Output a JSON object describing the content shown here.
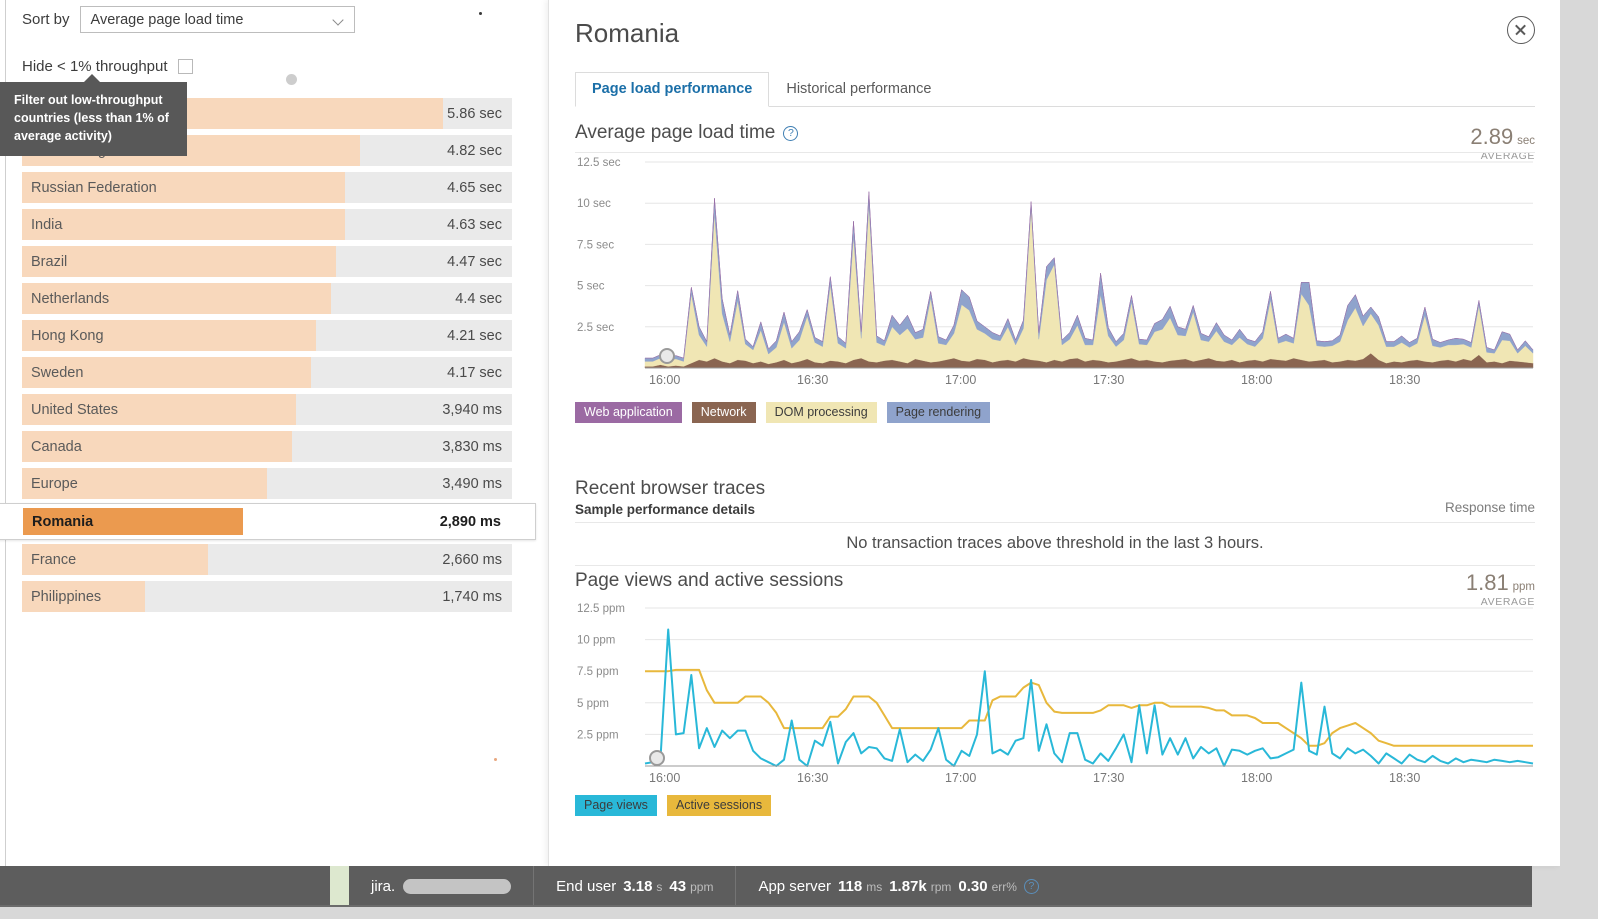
{
  "controls": {
    "sort_label": "Sort by",
    "sort_value": "Average page load time",
    "hide_label": "Hide < 1% throughput",
    "tooltip": "Filter out low-throughput countries (less than 1% of average activity)"
  },
  "country_list": [
    {
      "name": "",
      "value": "5.86 sec",
      "pct": 86,
      "selected": false
    },
    {
      "name": "United Kingdom",
      "value": "4.82 sec",
      "pct": 69,
      "selected": false
    },
    {
      "name": "Russian Federation",
      "value": "4.65 sec",
      "pct": 66,
      "selected": false
    },
    {
      "name": "India",
      "value": "4.63 sec",
      "pct": 66,
      "selected": false
    },
    {
      "name": "Brazil",
      "value": "4.47 sec",
      "pct": 64,
      "selected": false
    },
    {
      "name": "Netherlands",
      "value": "4.4 sec",
      "pct": 63,
      "selected": false
    },
    {
      "name": "Hong Kong",
      "value": "4.21 sec",
      "pct": 60,
      "selected": false
    },
    {
      "name": "Sweden",
      "value": "4.17 sec",
      "pct": 59,
      "selected": false
    },
    {
      "name": "United States",
      "value": "3,940 ms",
      "pct": 56,
      "selected": false
    },
    {
      "name": "Canada",
      "value": "3,830 ms",
      "pct": 55,
      "selected": false
    },
    {
      "name": "Europe",
      "value": "3,490 ms",
      "pct": 50,
      "selected": false
    },
    {
      "name": "Romania",
      "value": "2,890 ms",
      "pct": 41,
      "selected": true
    },
    {
      "name": "France",
      "value": "2,660 ms",
      "pct": 38,
      "selected": false
    },
    {
      "name": "Philippines",
      "value": "1,740 ms",
      "pct": 25,
      "selected": false
    }
  ],
  "panel": {
    "title": "Romania",
    "close_icon": "close-circle-icon",
    "tabs": [
      {
        "label": "Page load performance",
        "active": true
      },
      {
        "label": "Historical performance",
        "active": false
      }
    ],
    "traces": {
      "title": "Recent browser traces",
      "subtitle": "Sample performance details",
      "response_label": "Response time",
      "empty_message": "No transaction traces above threshold in the last 3 hours."
    }
  },
  "chart_data": [
    {
      "type": "area",
      "name": "page-load-time-chart",
      "title": "Average page load time",
      "help_icon": "help-circle-icon",
      "metric_value": "2.89",
      "metric_unit": "sec",
      "metric_caption": "AVERAGE",
      "ylabel": "",
      "xlabel": "",
      "ylim": [
        0,
        12.5
      ],
      "yticks": [
        "12.5 sec",
        "10 sec",
        "7.5 sec",
        "5 sec",
        "2.5 sec"
      ],
      "ytick_values": [
        12.5,
        10,
        7.5,
        5,
        2.5
      ],
      "xticks": [
        "16:00",
        "16:30",
        "17:00",
        "17:30",
        "18:00",
        "18:30"
      ],
      "grid": true,
      "stacked": true,
      "legend_position": "bottom",
      "series": [
        {
          "name": "Web application",
          "color": "#9b6aa3",
          "values": [
            0,
            0,
            0,
            0,
            0,
            0,
            0,
            0,
            0,
            0,
            0,
            0,
            0,
            0,
            0,
            0,
            0,
            0,
            0,
            0,
            0,
            0,
            0,
            0,
            0,
            0,
            0,
            0,
            0,
            0,
            0,
            0,
            0,
            0,
            0,
            0,
            0,
            0,
            0,
            0,
            0,
            0,
            0,
            0,
            0,
            0,
            0,
            0,
            0,
            0,
            0,
            0,
            0,
            0,
            0,
            0,
            0,
            0,
            0,
            0,
            0,
            0,
            0,
            0,
            0,
            0,
            0,
            0,
            0,
            0,
            0,
            0,
            0,
            0,
            0,
            0,
            0,
            0,
            0,
            0,
            0,
            0,
            0,
            0,
            0,
            0,
            0,
            0,
            0,
            0,
            0,
            0,
            0,
            0,
            0,
            0,
            0,
            0,
            0,
            0,
            0,
            0,
            0,
            0,
            0,
            0,
            0,
            0,
            0,
            0,
            0,
            0,
            0,
            0,
            0,
            0
          ]
        },
        {
          "name": "Network",
          "color": "#8a6551",
          "values": [
            0.1,
            0.1,
            0.2,
            0.1,
            0.15,
            0.1,
            0.3,
            0.5,
            0.4,
            0.6,
            0.4,
            0.3,
            0.5,
            0.45,
            0.3,
            0.4,
            0.25,
            0.35,
            0.5,
            0.3,
            0.4,
            0.55,
            0.35,
            0.3,
            0.45,
            0.4,
            0.3,
            0.5,
            0.6,
            0.4,
            0.35,
            0.45,
            0.5,
            0.4,
            0.3,
            0.55,
            0.45,
            0.35,
            0.4,
            0.5,
            0.6,
            0.45,
            0.4,
            0.55,
            0.5,
            0.35,
            0.45,
            0.5,
            0.4,
            0.6,
            0.5,
            0.45,
            0.35,
            0.5,
            0.4,
            0.55,
            0.6,
            0.4,
            0.5,
            0.45,
            0.35,
            0.4,
            0.5,
            0.6,
            0.45,
            0.5,
            0.4,
            0.35,
            0.45,
            0.5,
            0.55,
            0.4,
            0.5,
            0.6,
            0.45,
            0.4,
            0.5,
            0.35,
            0.45,
            0.5,
            0.4,
            0.55,
            0.5,
            0.45,
            0.6,
            0.5,
            0.4,
            0.45,
            0.5,
            0.35,
            0.4,
            0.5,
            0.45,
            0.55,
            0.9,
            0.5,
            0.3,
            0.4,
            0.35,
            0.45,
            0.5,
            0.4,
            0.35,
            0.45,
            0.5,
            0.4,
            0.55,
            0.45,
            0.8,
            0.35,
            0.4,
            0.3,
            0.45,
            0.4,
            0.35,
            0.3
          ]
        },
        {
          "name": "DOM processing",
          "color": "#f0e6b4",
          "values": [
            0.3,
            0.3,
            0.4,
            0.35,
            0.4,
            0.3,
            4.2,
            1.5,
            0.9,
            8.8,
            2.9,
            1.3,
            3.6,
            1.0,
            0.8,
            1.9,
            0.6,
            0.9,
            2.3,
            0.9,
            1.3,
            2.6,
            1.2,
            1.0,
            4.6,
            1.1,
            0.9,
            7.5,
            1.2,
            9.5,
            1.2,
            0.9,
            2.0,
            1.6,
            2.1,
            1.2,
            1.4,
            3.9,
            1.1,
            0.9,
            1.5,
            3.4,
            3.1,
            1.8,
            1.6,
            1.4,
            1.2,
            2.0,
            1.0,
            1.8,
            9.2,
            1.3,
            5.0,
            5.8,
            1.0,
            1.2,
            2.0,
            1.0,
            0.9,
            4.0,
            1.6,
            0.9,
            1.2,
            3.4,
            1.0,
            0.9,
            1.8,
            2.0,
            2.6,
            1.5,
            1.4,
            3.0,
            1.2,
            1.0,
            1.8,
            1.2,
            0.9,
            1.5,
            1.0,
            0.8,
            1.4,
            3.6,
            1.0,
            1.2,
            0.9,
            4.0,
            3.4,
            0.9,
            0.8,
            1.0,
            1.2,
            2.4,
            3.2,
            2.0,
            2.4,
            2.1,
            1.0,
            0.9,
            1.2,
            0.8,
            1.0,
            2.8,
            1.0,
            0.8,
            0.9,
            1.0,
            0.9,
            0.8,
            3.0,
            0.6,
            0.5,
            1.4,
            1.2,
            0.5,
            1.0,
            0.6
          ]
        },
        {
          "name": "Page rendering",
          "color": "#8fa3cc",
          "values": [
            0.2,
            0.2,
            0.2,
            0.2,
            0.2,
            0.2,
            0.4,
            0.5,
            0.3,
            0.9,
            0.9,
            0.4,
            0.6,
            0.3,
            0.2,
            0.5,
            0.3,
            0.4,
            0.6,
            0.4,
            0.5,
            0.4,
            0.3,
            0.3,
            0.5,
            0.4,
            0.3,
            0.9,
            0.4,
            0.8,
            0.4,
            0.3,
            0.7,
            0.6,
            0.8,
            0.4,
            0.5,
            0.4,
            0.4,
            0.3,
            0.5,
            0.9,
            0.8,
            0.5,
            0.4,
            0.4,
            0.3,
            0.5,
            0.3,
            0.5,
            0.4,
            0.4,
            0.8,
            0.4,
            0.3,
            0.4,
            0.6,
            0.4,
            0.3,
            1.3,
            0.5,
            0.3,
            0.4,
            0.4,
            0.3,
            0.3,
            0.5,
            0.6,
            0.7,
            0.5,
            0.4,
            0.4,
            0.4,
            0.3,
            0.5,
            0.4,
            0.3,
            0.5,
            0.3,
            0.3,
            0.4,
            0.5,
            0.3,
            0.4,
            0.3,
            0.7,
            1.4,
            0.3,
            0.3,
            0.3,
            0.4,
            0.9,
            0.8,
            0.6,
            0.4,
            0.5,
            0.3,
            0.3,
            0.4,
            0.3,
            0.3,
            0.5,
            0.4,
            0.3,
            0.3,
            0.4,
            0.3,
            0.3,
            0.3,
            0.3,
            0.2,
            0.5,
            0.4,
            0.2,
            0.3,
            0.2
          ]
        }
      ]
    },
    {
      "type": "line",
      "name": "page-views-sessions-chart",
      "title": "Page views and active sessions",
      "metric_value": "1.81",
      "metric_unit": "ppm",
      "metric_caption": "AVERAGE",
      "ylim": [
        0,
        12.5
      ],
      "yticks": [
        "12.5 ppm",
        "10 ppm",
        "7.5 ppm",
        "5 ppm",
        "2.5 ppm"
      ],
      "ytick_values": [
        12.5,
        10,
        7.5,
        5,
        2.5
      ],
      "xticks": [
        "16:00",
        "16:30",
        "17:00",
        "17:30",
        "18:00",
        "18:30"
      ],
      "grid": true,
      "legend_position": "bottom",
      "series": [
        {
          "name": "Page views",
          "color": "#29b8d8",
          "values": [
            0.2,
            0.3,
            0.5,
            10.8,
            2.5,
            2.6,
            7.2,
            1.4,
            3.0,
            1.5,
            2.8,
            2.2,
            2.8,
            2.8,
            1.2,
            0.6,
            0.3,
            0.0,
            0.5,
            3.6,
            0.5,
            0.0,
            2.0,
            1.6,
            3.5,
            0.2,
            1.9,
            2.6,
            1.0,
            1.5,
            1.4,
            0.6,
            0.4,
            2.9,
            0.3,
            0.9,
            0.4,
            1.3,
            3.0,
            0.5,
            0.0,
            1.2,
            0.8,
            2.5,
            7.5,
            1.0,
            1.3,
            0.9,
            2.0,
            2.2,
            6.8,
            1.2,
            3.3,
            1.0,
            0.3,
            2.6,
            2.6,
            0.5,
            0.2,
            1.0,
            0.4,
            1.4,
            2.5,
            0.3,
            4.8,
            1.0,
            4.8,
            0.9,
            2.2,
            0.9,
            2.2,
            0.6,
            1.5,
            1.0,
            1.4,
            0.0,
            1.3,
            1.2,
            0.9,
            1.2,
            1.4,
            0.6,
            0.7,
            1.0,
            1.3,
            6.6,
            1.2,
            0.9,
            4.7,
            1.0,
            0.6,
            1.4,
            1.0,
            1.3,
            0.8,
            0.2,
            1.0,
            0.6,
            0.2,
            0.9,
            0.5,
            0.3,
            0.8,
            0.4,
            0.2,
            0.6,
            0.3,
            0.5,
            0.4,
            0.3,
            0.5,
            0.4,
            0.3,
            0.4,
            0.3,
            0.2
          ]
        },
        {
          "name": "Active sessions",
          "color": "#e8b83c",
          "values": [
            7.5,
            7.5,
            7.5,
            7.5,
            7.6,
            7.6,
            7.6,
            7.6,
            6.0,
            5.0,
            5.0,
            5.0,
            5.0,
            5.5,
            5.5,
            5.5,
            5.0,
            4.2,
            3.0,
            3.0,
            3.0,
            3.0,
            3.0,
            3.0,
            3.9,
            3.9,
            4.5,
            5.5,
            5.5,
            5.5,
            5.0,
            4.0,
            3.0,
            3.0,
            3.0,
            3.0,
            3.0,
            3.0,
            3.0,
            3.0,
            3.0,
            3.0,
            3.6,
            3.6,
            3.6,
            5.2,
            5.5,
            5.5,
            5.5,
            6.2,
            6.6,
            6.4,
            5.0,
            4.3,
            4.2,
            4.2,
            4.2,
            4.2,
            4.2,
            4.4,
            4.8,
            4.8,
            4.8,
            4.6,
            4.8,
            4.8,
            5.0,
            5.0,
            4.7,
            4.7,
            4.7,
            4.7,
            4.7,
            4.6,
            4.4,
            4.4,
            4.0,
            4.0,
            4.0,
            3.8,
            3.4,
            3.4,
            3.4,
            3.0,
            2.6,
            2.2,
            1.6,
            1.6,
            1.8,
            2.6,
            3.0,
            3.2,
            3.4,
            3.0,
            2.6,
            2.0,
            1.8,
            1.6,
            1.6,
            1.6,
            1.6,
            1.6,
            1.6,
            1.6,
            1.6,
            1.6,
            1.6,
            1.6,
            1.6,
            1.6,
            1.6,
            1.6,
            1.6,
            1.6,
            1.6,
            1.6
          ]
        }
      ]
    }
  ],
  "statusbar": {
    "app_name": "jira.",
    "redacted": true,
    "cells": [
      {
        "name": "End user",
        "metrics": [
          {
            "num": "3.18",
            "unit": "s"
          },
          {
            "num": "43",
            "unit": "ppm"
          }
        ]
      },
      {
        "name": "App server",
        "metrics": [
          {
            "num": "118",
            "unit": "ms"
          },
          {
            "num": "1.87k",
            "unit": "rpm"
          },
          {
            "num": "0.30",
            "unit": "err%"
          }
        ]
      }
    ],
    "help_icon": "help-circle-icon"
  },
  "colors": {
    "bar_fill": "#f8d8bc",
    "bar_selected": "#eb9a4f",
    "bar_track": "#eaeaea",
    "accent_link": "#1b6fa8",
    "statusbar_bg": "#5d5d5d"
  }
}
